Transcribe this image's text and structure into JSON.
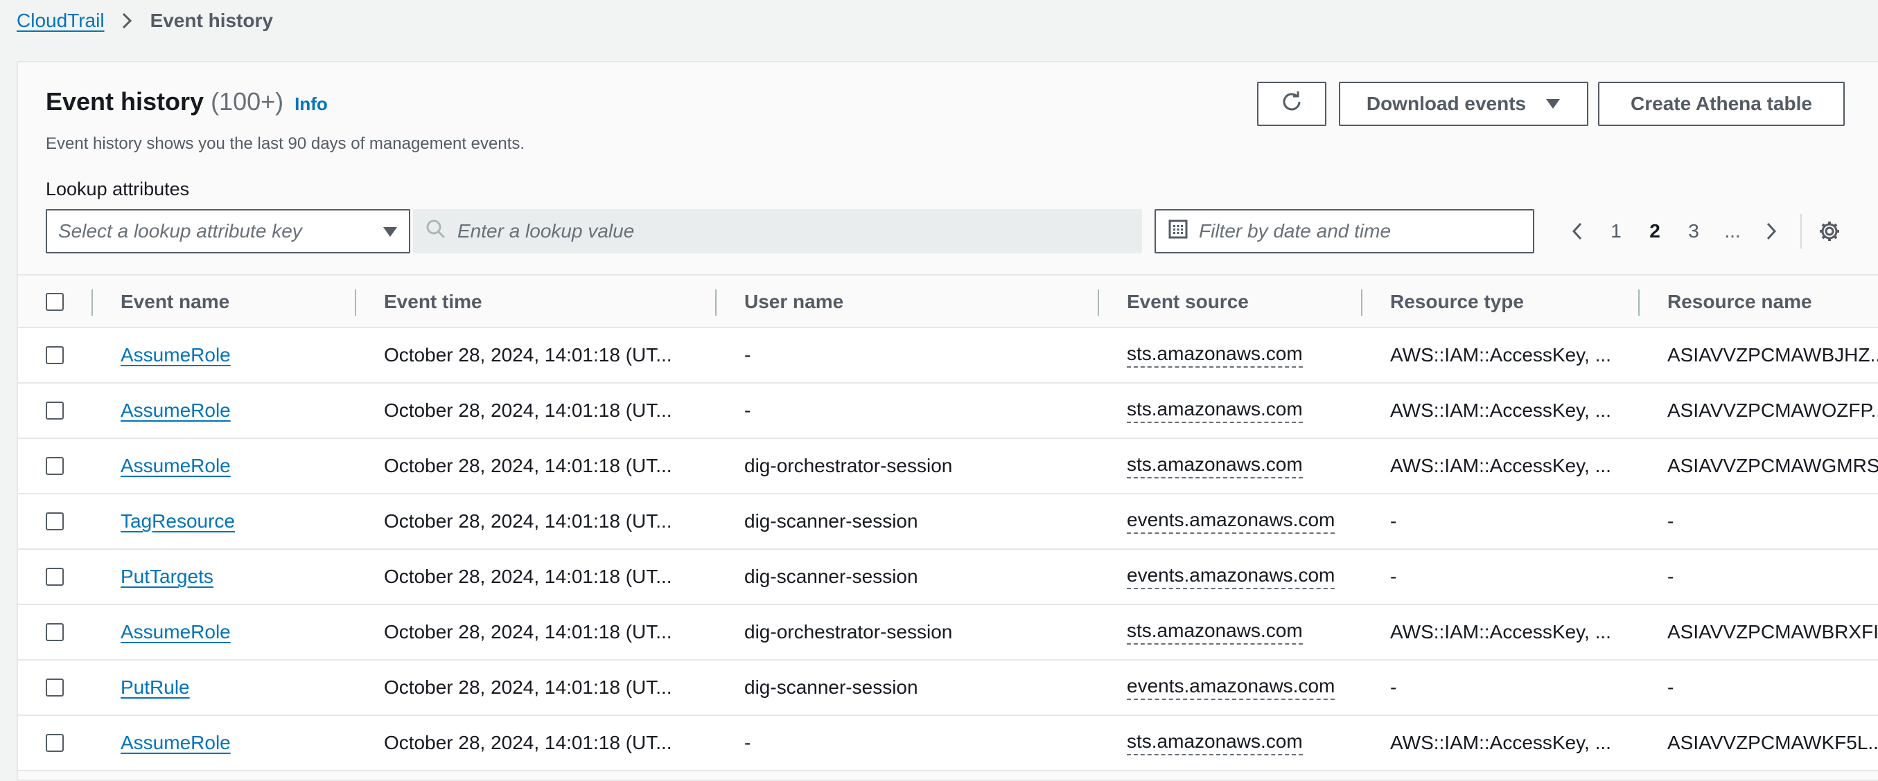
{
  "breadcrumb": {
    "root": "CloudTrail",
    "current": "Event history"
  },
  "header": {
    "title": "Event history",
    "count": "(100+)",
    "info": "Info",
    "subtitle": "Event history shows you the last 90 days of management events.",
    "download_label": "Download events",
    "athena_label": "Create Athena table"
  },
  "lookup": {
    "label": "Lookup attributes",
    "key_placeholder": "Select a lookup attribute key",
    "value_placeholder": "Enter a lookup value",
    "date_placeholder": "Filter by date and time"
  },
  "pagination": {
    "pages": [
      "1",
      "2",
      "3"
    ],
    "current": "2",
    "ellipsis": "..."
  },
  "table": {
    "columns": [
      "Event name",
      "Event time",
      "User name",
      "Event source",
      "Resource type",
      "Resource name"
    ],
    "rows": [
      {
        "name": "AssumeRole",
        "time": "October 28, 2024, 14:01:18 (UT...",
        "user": "-",
        "source": "sts.amazonaws.com",
        "rtype": "AWS::IAM::AccessKey, ...",
        "rname": "ASIAVVZPCMAWBJHZ..."
      },
      {
        "name": "AssumeRole",
        "time": "October 28, 2024, 14:01:18 (UT...",
        "user": "-",
        "source": "sts.amazonaws.com",
        "rtype": "AWS::IAM::AccessKey, ...",
        "rname": "ASIAVVZPCMAWOZFP..."
      },
      {
        "name": "AssumeRole",
        "time": "October 28, 2024, 14:01:18 (UT...",
        "user": "dig-orchestrator-session",
        "source": "sts.amazonaws.com",
        "rtype": "AWS::IAM::AccessKey, ...",
        "rname": "ASIAVVZPCMAWGMRS..."
      },
      {
        "name": "TagResource",
        "time": "October 28, 2024, 14:01:18 (UT...",
        "user": "dig-scanner-session",
        "source": "events.amazonaws.com",
        "rtype": "-",
        "rname": "-"
      },
      {
        "name": "PutTargets",
        "time": "October 28, 2024, 14:01:18 (UT...",
        "user": "dig-scanner-session",
        "source": "events.amazonaws.com",
        "rtype": "-",
        "rname": "-"
      },
      {
        "name": "AssumeRole",
        "time": "October 28, 2024, 14:01:18 (UT...",
        "user": "dig-orchestrator-session",
        "source": "sts.amazonaws.com",
        "rtype": "AWS::IAM::AccessKey, ...",
        "rname": "ASIAVVZPCMAWBRXFI..."
      },
      {
        "name": "PutRule",
        "time": "October 28, 2024, 14:01:18 (UT...",
        "user": "dig-scanner-session",
        "source": "events.amazonaws.com",
        "rtype": "-",
        "rname": "-"
      },
      {
        "name": "AssumeRole",
        "time": "October 28, 2024, 14:01:18 (UT...",
        "user": "-",
        "source": "sts.amazonaws.com",
        "rtype": "AWS::IAM::AccessKey, ...",
        "rname": "ASIAVVZPCMAWKF5L..."
      }
    ]
  },
  "colors": {
    "link": "#0073bb",
    "border": "#545b64",
    "muted": "#687078"
  }
}
